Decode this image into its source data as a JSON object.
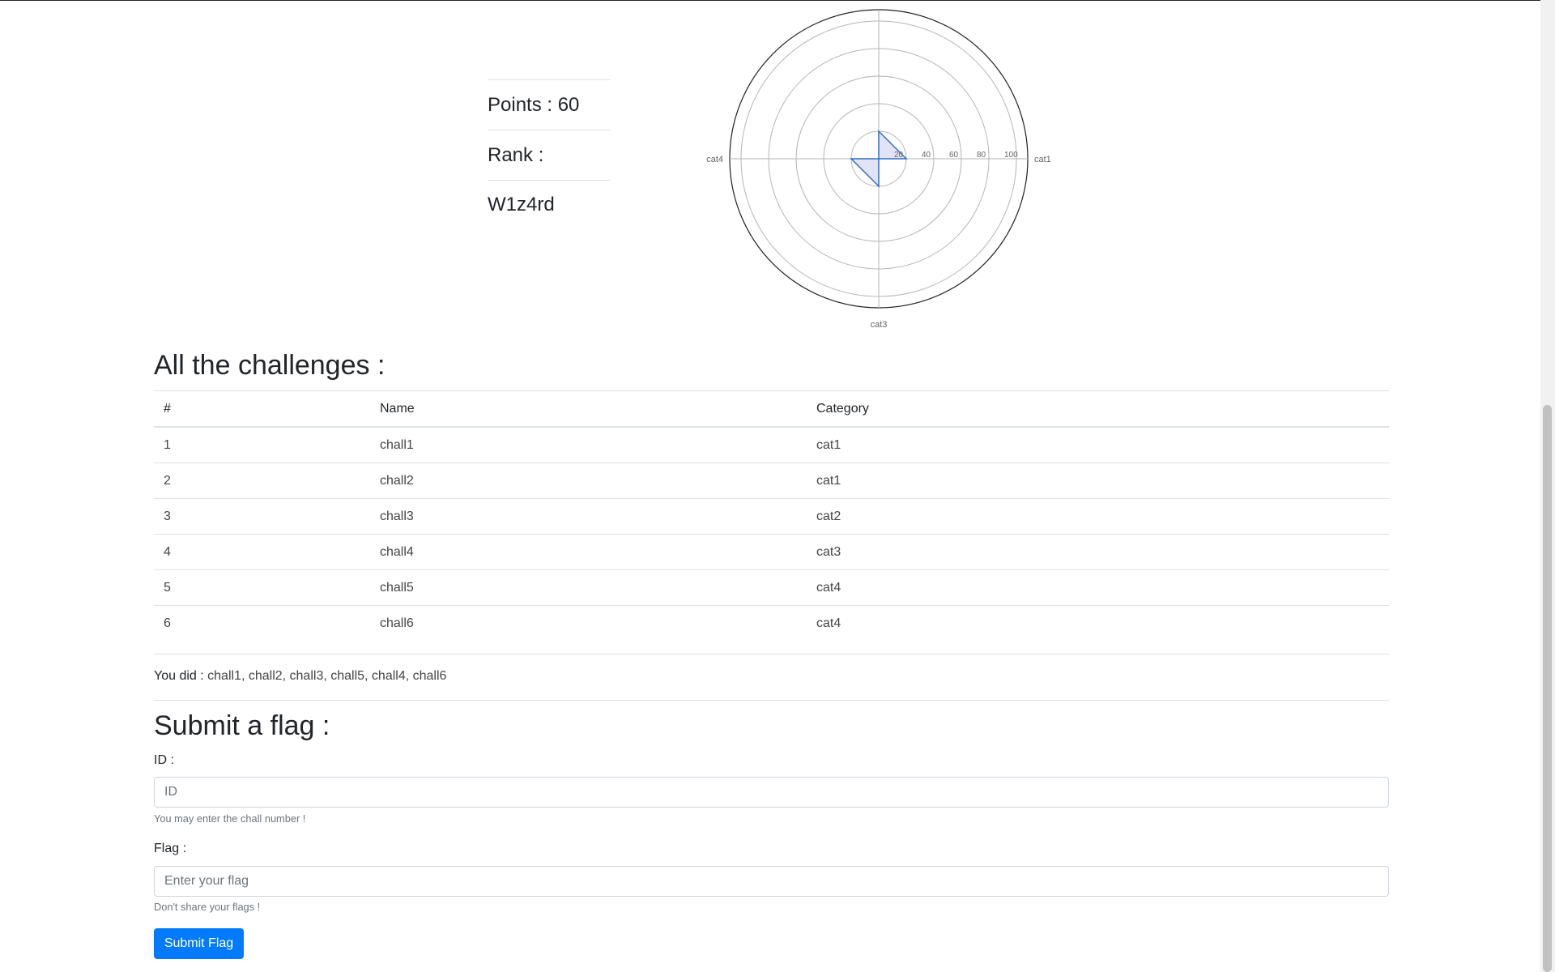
{
  "stats": {
    "points_label": "Points : 60",
    "rank_label": "Rank : W1z4rd"
  },
  "chart_data": {
    "type": "radar",
    "axes": [
      "cat1",
      "cat2",
      "cat3",
      "cat4"
    ],
    "axis_labels_shown": [
      "cat1",
      "cat3",
      "cat4"
    ],
    "r_ticks": [
      "20",
      "40",
      "60",
      "80",
      "100"
    ],
    "rlim": [
      0,
      100
    ],
    "series": [
      {
        "values": [
          20,
          20,
          20,
          20
        ]
      }
    ],
    "colors": {
      "line": "#2f6fbf",
      "fill": "#dcdcf4"
    }
  },
  "challenges": {
    "title": "All the challenges :",
    "headers": [
      "#",
      "Name",
      "Category"
    ],
    "rows": [
      [
        "1",
        "chall1",
        "cat1"
      ],
      [
        "2",
        "chall2",
        "cat1"
      ],
      [
        "3",
        "chall3",
        "cat2"
      ],
      [
        "4",
        "chall4",
        "cat3"
      ],
      [
        "5",
        "chall5",
        "cat4"
      ],
      [
        "6",
        "chall6",
        "cat4"
      ]
    ]
  },
  "done": {
    "label": "You did :",
    "value": "chall1, chall2, chall3, chall5, chall4, chall6"
  },
  "submit": {
    "title": "Submit a flag :",
    "id_label": "ID :",
    "id_placeholder": "ID",
    "id_help": "You may enter the chall number !",
    "flag_label": "Flag :",
    "flag_placeholder": "Enter your flag",
    "flag_help": "Don't share your flags !",
    "button_label": "Submit Flag"
  },
  "colors": {
    "button": "#007bff",
    "border": "#dee2e6"
  }
}
